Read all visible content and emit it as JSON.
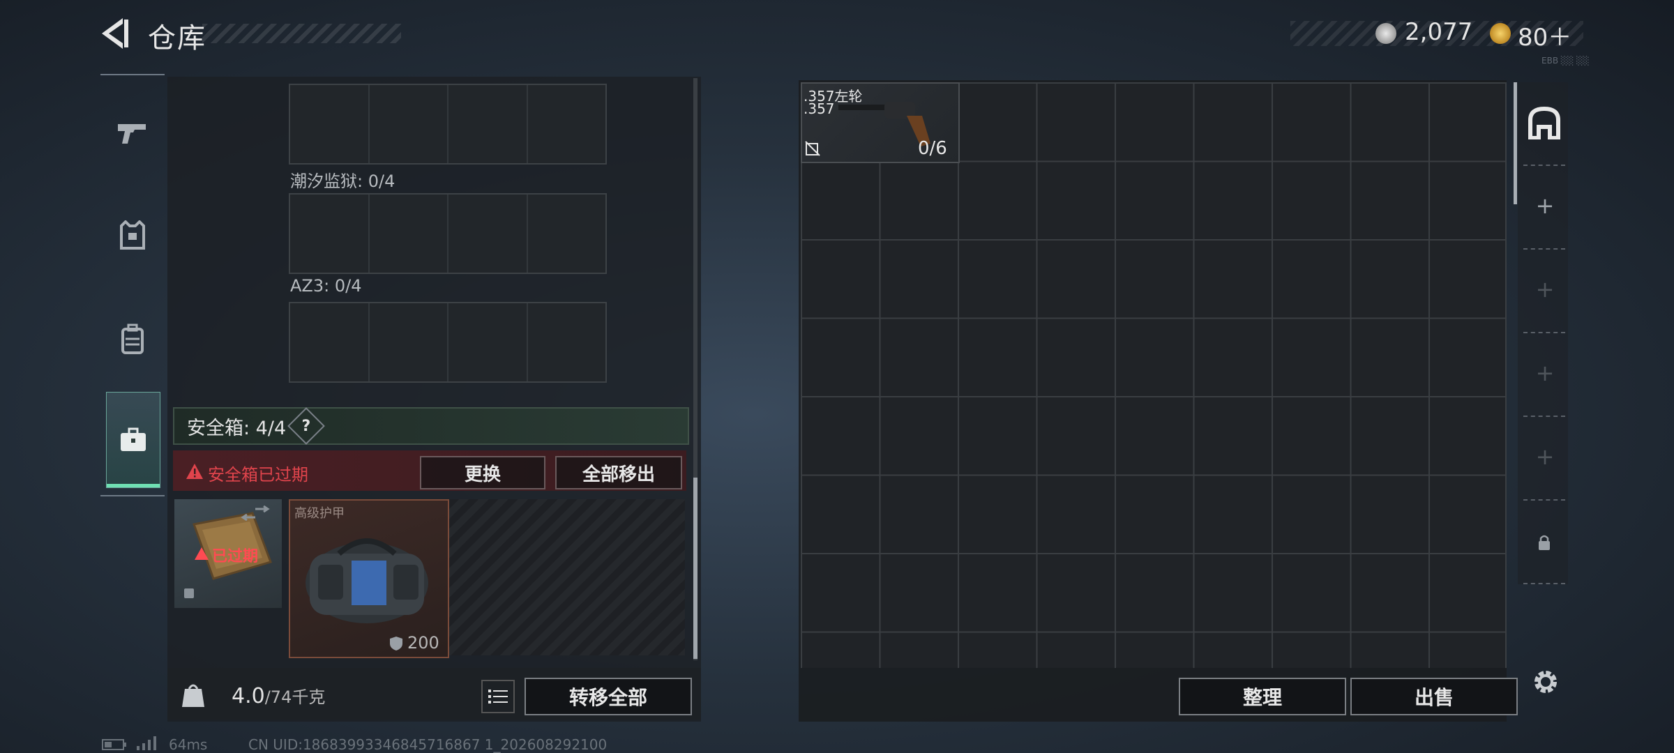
{
  "header": {
    "title": "仓库",
    "currency_silver": "2,077",
    "currency_gold": "80＋",
    "tiny_code": "EBB ░░ ░░"
  },
  "rail": {
    "items": [
      {
        "name": "weapon"
      },
      {
        "name": "armor"
      },
      {
        "name": "backpack"
      },
      {
        "name": "safebox",
        "active": true
      }
    ]
  },
  "left": {
    "slots": [
      {
        "label": "潮汐监狱: 0/4"
      },
      {
        "label": "AZ3: 0/4"
      }
    ],
    "safe_box": {
      "title": "安全箱: 4/4",
      "help": "?",
      "expired_msg": "安全箱已过期",
      "replace_btn": "更换",
      "move_all_btn": "全部移出",
      "case_status": "已过期",
      "bag_name": "高级护甲",
      "bag_value": "200"
    },
    "weight_value": "4.0",
    "weight_max": "/74千克",
    "transfer_btn": "转移全部"
  },
  "stash": {
    "item_name": ".357左轮",
    "item_caliber": ".357",
    "item_ammo": "0/6",
    "sort_btn": "整理",
    "sell_btn": "出售"
  },
  "status": {
    "ping": "64ms",
    "uid": "CN UID:18683993346845716867 1_202608292100"
  },
  "colors": {
    "accent_green": "#6fe0b3",
    "warning_red": "#e0444c",
    "gold": "#c08b25"
  }
}
